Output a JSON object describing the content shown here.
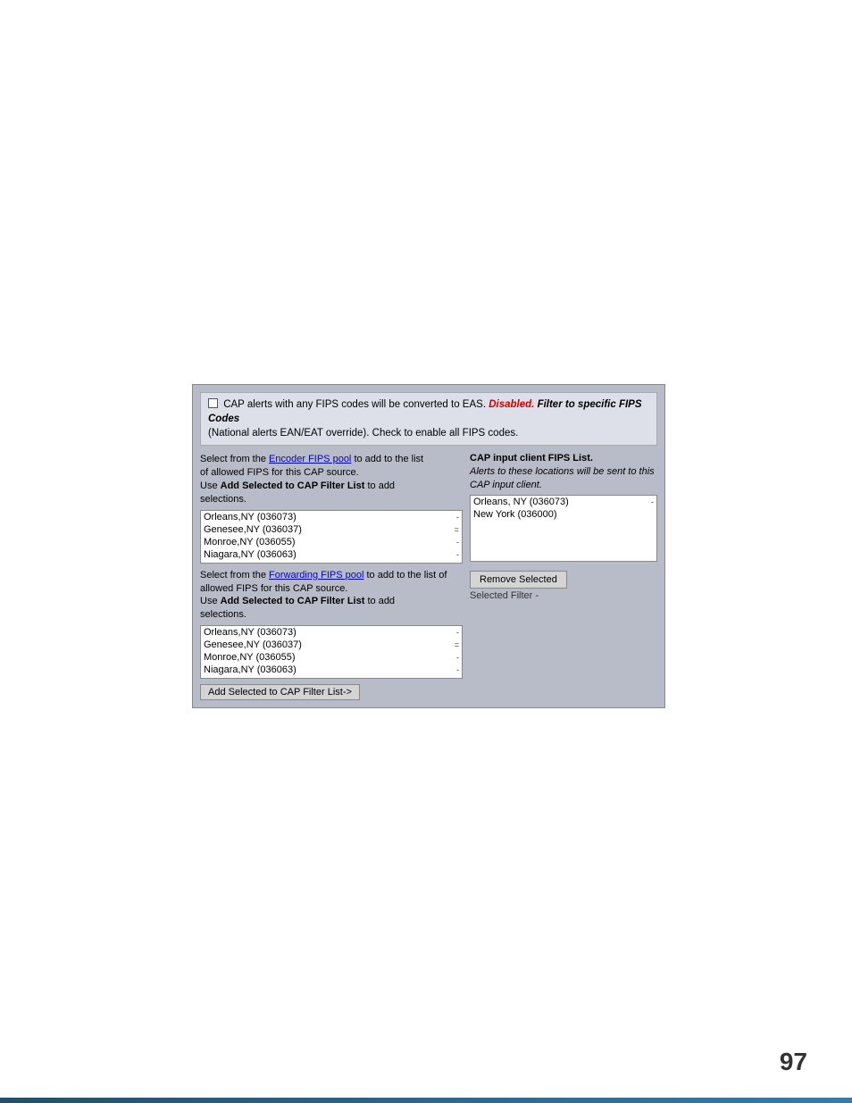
{
  "page": {
    "number": "97",
    "top_notice": {
      "checkbox_label": "CAP alerts with any FIPS codes will be converted to EAS.",
      "disabled_text": "Disabled.",
      "filter_text": "Filter to specific FIPS Codes",
      "national_text": "(National alerts EAN/EAT override).",
      "check_text": "Check to enable all FIPS codes."
    },
    "left_section": {
      "encoder_text1": "Select from the",
      "encoder_link": "Encoder FIPS pool",
      "encoder_text2": "to add to the list",
      "encoder_text3": "of allowed FIPS for this CAP source.",
      "encoder_text4": "Use",
      "encoder_bold": "Add Selected to CAP Filter List",
      "encoder_text5": "to add",
      "encoder_text6": "selections.",
      "encoder_items": [
        {
          "label": "Orleans,NY (036073)",
          "arrow": "-"
        },
        {
          "label": "Genesee,NY (036037)",
          "arrow": "="
        },
        {
          "label": "Monroe,NY (036055)",
          "arrow": "-"
        },
        {
          "label": "Niagara,NY (036063)",
          "arrow": "-"
        }
      ],
      "forwarding_text1": "Select from the",
      "forwarding_link": "Forwarding FIPS pool",
      "forwarding_text2": "to add to the",
      "forwarding_text3": "list of allowed FIPS for this CAP source.",
      "forwarding_text4": "Use",
      "forwarding_bold": "Add Selected to CAP Filter List",
      "forwarding_text5": "to add",
      "forwarding_text6": "selections.",
      "forwarding_items": [
        {
          "label": "Orleans,NY (036073)",
          "arrow": "-"
        },
        {
          "label": "Genesee,NY (036037)",
          "arrow": "="
        },
        {
          "label": "Monroe,NY (036055)",
          "arrow": "-"
        },
        {
          "label": "Niagara,NY (036063)",
          "arrow": "-"
        }
      ],
      "add_button_label": "Add Selected to CAP Filter List->"
    },
    "right_section": {
      "heading": "CAP input client FIPS List.",
      "subtext": "Alerts to these locations will be sent to this CAP input client.",
      "items": [
        {
          "label": "Orleans, NY (036073)",
          "arrow": "-"
        },
        {
          "label": "New York (036000)",
          "arrow": ""
        }
      ],
      "remove_button": "Remove Selected",
      "selected_filter": "Selected Filter -"
    }
  }
}
